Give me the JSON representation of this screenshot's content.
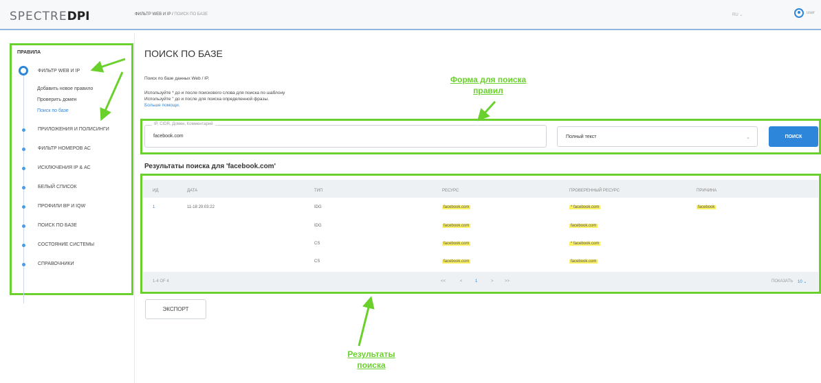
{
  "header": {
    "logo_text": "SPECTRE",
    "logo_bold": "DPI",
    "breadcrumb_parent": "ФИЛЬТР WEB И IP",
    "breadcrumb_sep": " / ",
    "breadcrumb_current": "ПОИСК ПО БАЗЕ",
    "lang": "RU ⌄",
    "user_name": "user"
  },
  "sidebar": {
    "title": "ПРАВИЛА",
    "items": [
      {
        "label": "ФИЛЬТР WEB И IP"
      },
      {
        "label": "ПРИЛОЖЕНИЯ И ПОЛИСИНГИ"
      },
      {
        "label": "ФИЛЬТР НОМЕРОВ АС"
      },
      {
        "label": "ИСКЛЮЧЕНИЯ IP & АС"
      },
      {
        "label": "БЕЛЫЙ СПИСОК"
      },
      {
        "label": "ПРОФИЛИ ВР И IQW"
      },
      {
        "label": "ПОИСК ПО БАЗЕ"
      },
      {
        "label": "СОСТОЯНИЕ СИСТЕМЫ"
      },
      {
        "label": "СПРАВОЧНИКИ"
      }
    ],
    "subitems": [
      {
        "label": "Добавить новое правило"
      },
      {
        "label": "Проверить домен"
      },
      {
        "label": "Поиск по базе"
      }
    ]
  },
  "main": {
    "title": "ПОИСК ПО БАЗЕ",
    "desc1": "Поиск по базе данных Web / IP.",
    "desc2": "Используйте * до и после поискового слова для поиска по шаблону",
    "desc3": "Используйте \" до и после для поиска определенной фразы.",
    "help_link": "Больше помощи.",
    "search_legend": "IP, CIDR, Домен, Комментарий",
    "search_value": "facebook.com",
    "mode_value": "Полный текст",
    "search_button": "ПОИСК",
    "results_title": "Результаты поиска для 'facebook.com'",
    "export_button": "ЭКСПОРТ"
  },
  "table": {
    "headers": [
      "ИД",
      "ДАТА",
      "ТИП",
      "РЕСУРС",
      "ПРОВЕРЕННЫЙ РЕСУРС",
      "ПРИЧИНА"
    ],
    "rows": [
      {
        "id": "1",
        "date": "11-18 20:03:22",
        "type": "IDG",
        "resource": "facebook.com",
        "checked": "* facebook.com",
        "reason": "facebook"
      },
      {
        "id": "",
        "date": "",
        "type": "IDG",
        "resource": "facebook.com",
        "checked": "facebook.com",
        "reason": ""
      },
      {
        "id": "",
        "date": "",
        "type": "CS",
        "resource": "facebook.com",
        "checked": "* facebook.com",
        "reason": ""
      },
      {
        "id": "",
        "date": "",
        "type": "CS",
        "resource": "facebook.com",
        "checked": "facebook.com",
        "reason": ""
      }
    ],
    "count": "1-4 OF 4",
    "pager": [
      "<<",
      "<",
      "1",
      ">",
      ">>"
    ],
    "show_label": "ПОКАЗАТЬ",
    "show_value": "10 ⌄"
  },
  "annotations": {
    "form_label_1": "Форма для поиска",
    "form_label_2": "правил",
    "results_label_1": "Результаты",
    "results_label_2": "поиска"
  },
  "colors": {
    "accent": "#2d86d9",
    "annotation": "#6ad12c",
    "highlight": "#fbf160"
  }
}
